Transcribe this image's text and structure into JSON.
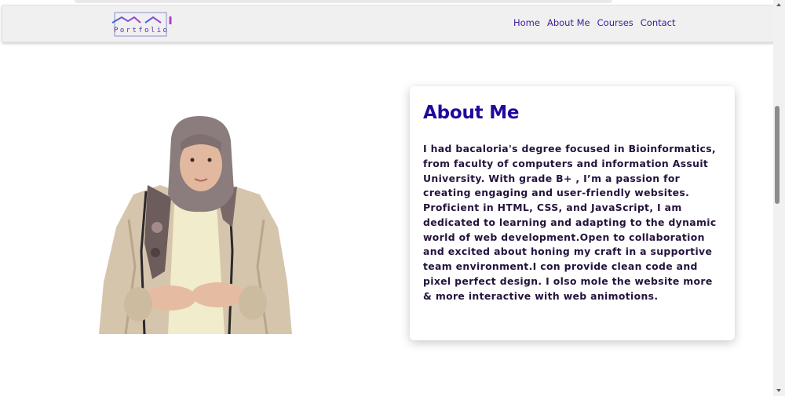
{
  "logo": {
    "text": "MAI",
    "subtext": "Portfolio"
  },
  "nav": {
    "items": [
      "Home",
      "About Me",
      "Courses",
      "Contact"
    ]
  },
  "about": {
    "heading": "About Me",
    "body": "I had bacaloria's degree focused in Bioinformatics, from faculty of computers and information Assuit University. With grade B+ , I’m a passion for creating engaging and user-friendly websites. Proficient in HTML, CSS, and JavaScript, I am dedicated to learning and adapting to the dynamic world of web development.Open to collaboration and excited about honing my craft in a supportive team environment.I con provide clean code and pixel perfect design. I olso mole the website more & more interactive with web animotions."
  },
  "colors": {
    "accent": "#1f0a9a",
    "nav_link": "#3d1d9a",
    "text": "#24133d",
    "navbar_bg": "#f0f0f0"
  },
  "icons": {
    "scroll_up": "triangle-up",
    "scroll_down": "triangle-down"
  }
}
